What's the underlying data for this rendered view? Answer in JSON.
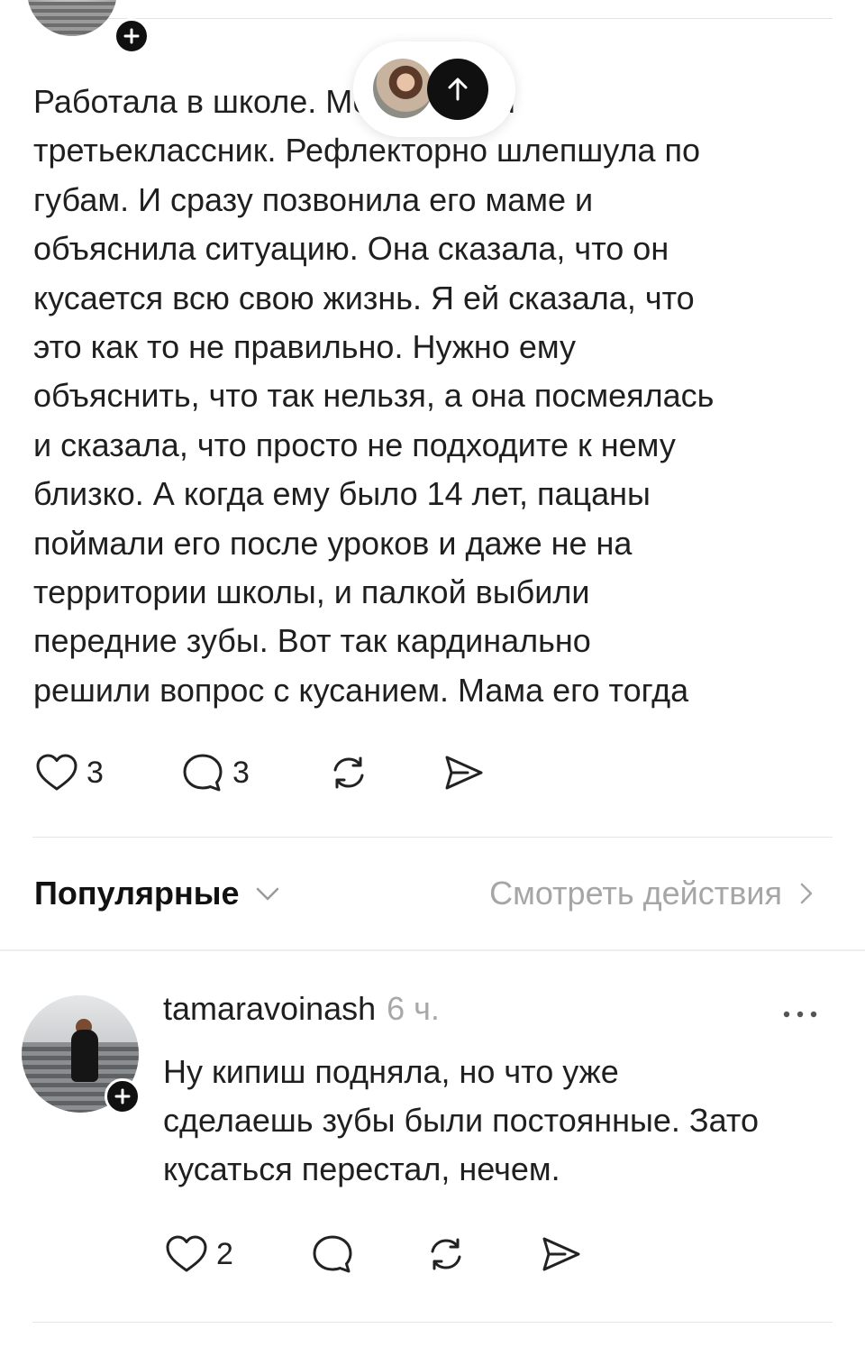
{
  "post": {
    "lines": [
      "Работала в школе. Меня укусил",
      "третьеклассник. Рефлекторно шлепшула по",
      "губам. И сразу позвонила его маме и",
      "объяснила ситуацию. Она сказала, что он",
      "кусается всю свою жизнь. Я ей сказала, что",
      "это как то не правильно. Нужно ему",
      "объяснить, что так нельзя, а она посмеялась",
      "и сказала, что просто не подходите к нему",
      "близко. А когда ему было 14 лет, пацаны",
      "поймали его после уроков и даже не на",
      "территории школы, и палкой выбили",
      "передние зубы. Вот так кардинально",
      "решили вопрос с кусанием. Мама его тогда"
    ],
    "likes": "3",
    "comments": "3"
  },
  "sort": {
    "label": "Популярные",
    "view_activity": "Смотреть действия"
  },
  "comment": {
    "username": "tamaravoinash",
    "time": "6 ч.",
    "lines": [
      "Ну кипиш подняла, но что уже",
      "сделаешь зубы были постоянные. Зато",
      "кусаться перестал, нечем."
    ],
    "likes": "2"
  },
  "icons": {
    "heart": "heart-icon",
    "comment": "comment-icon",
    "repost": "repost-icon",
    "share": "send-icon",
    "plus": "plus-icon",
    "up": "arrow-up-icon",
    "more": "more-icon",
    "chevron_down": "chevron-down-icon",
    "chevron_right": "chevron-right-icon"
  }
}
